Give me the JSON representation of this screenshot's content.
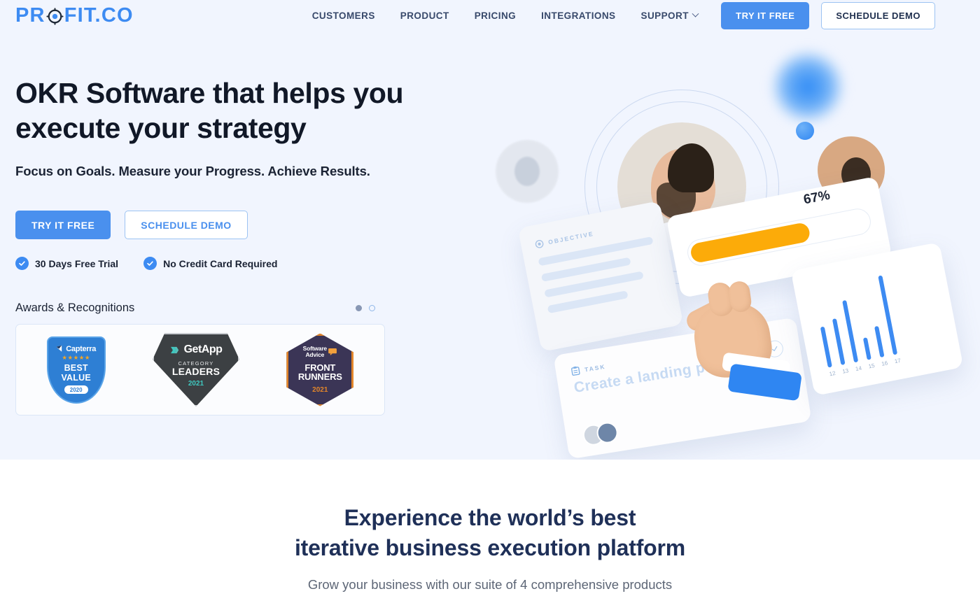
{
  "brand": {
    "logo_text_before": "PR",
    "logo_icon": "target-icon",
    "logo_text_after": "FIT.CO",
    "accent_blue": "#3d8bf2",
    "button_blue": "#4a90ee",
    "hero_bg": "#f1f5fe",
    "orange": "#fcab09"
  },
  "header": {
    "nav": [
      {
        "label": "CUSTOMERS",
        "has_dropdown": false
      },
      {
        "label": "PRODUCT",
        "has_dropdown": false
      },
      {
        "label": "PRICING",
        "has_dropdown": false
      },
      {
        "label": "INTEGRATIONS",
        "has_dropdown": false
      },
      {
        "label": "SUPPORT",
        "has_dropdown": true
      }
    ],
    "try_free_label": "TRY IT FREE",
    "schedule_demo_label": "SCHEDULE DEMO"
  },
  "hero": {
    "title_line1": "OKR Software that helps you",
    "title_line2": "execute your strategy",
    "subtitle": "Focus on Goals. Measure your Progress. Achieve Results.",
    "cta_primary": "TRY IT FREE",
    "cta_secondary": "SCHEDULE DEMO",
    "trust": [
      {
        "label": "30 Days Free Trial",
        "icon": "check-circle-icon"
      },
      {
        "label": "No Credit Card Required",
        "icon": "check-circle-icon"
      }
    ]
  },
  "awards": {
    "title": "Awards & Recognitions",
    "carousel_dots": [
      {
        "state": "active"
      },
      {
        "state": "idle"
      }
    ],
    "badges": [
      {
        "brand": "Capterra",
        "stars": "★★★★★",
        "award_line1": "BEST",
        "award_line2": "VALUE",
        "year": "2020"
      },
      {
        "brand": "GetApp",
        "category": "CATEGORY",
        "award": "LEADERS",
        "year": "2021"
      },
      {
        "brand_line1": "Software",
        "brand_line2": "Advice",
        "award_line1": "FRONT",
        "award_line2": "RUNNERS",
        "year": "2021"
      }
    ]
  },
  "illustration": {
    "objective_card_label": "OBJECTIVE",
    "progress_percent_label": "67%",
    "progress_value": 67,
    "task_card_label": "TASK",
    "task_card_text": "Create a landing page",
    "chart_bar_labels": [
      "12",
      "13",
      "14",
      "15",
      "16",
      "17"
    ]
  },
  "chart_data": {
    "type": "bar",
    "title": "",
    "categories": [
      "12",
      "13",
      "14",
      "15",
      "16",
      "17"
    ],
    "values": [
      62,
      72,
      96,
      34,
      48,
      122
    ],
    "xlabel": "",
    "ylabel": "",
    "ylim": [
      0,
      130
    ],
    "grid": false,
    "legend": "none",
    "series": [
      {
        "name": "activity",
        "values": [
          62,
          72,
          96,
          34,
          48,
          122
        ]
      }
    ]
  },
  "section2": {
    "title_line1": "Experience the world’s best",
    "title_line2": "iterative business execution platform",
    "subtitle": "Grow your business with our suite of 4 comprehensive products"
  }
}
